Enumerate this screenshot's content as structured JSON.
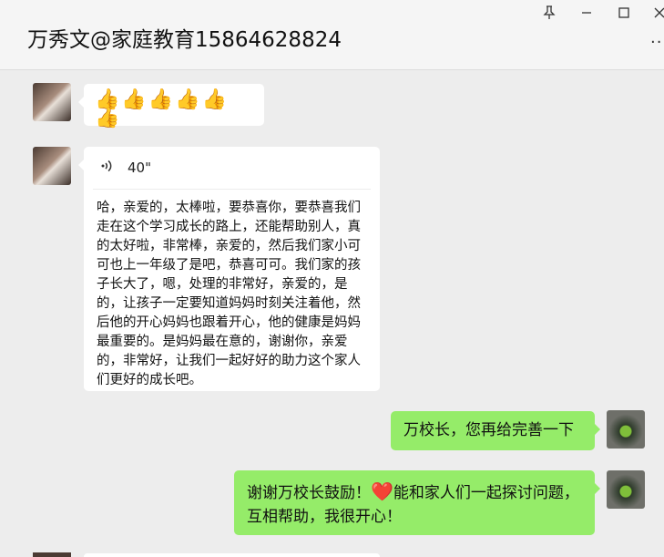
{
  "window": {
    "title": "万秀文@家庭教育15864628824",
    "pin_icon": "pin-icon",
    "minimize_icon": "minimize-icon",
    "maximize_icon": "maximize-icon",
    "close_icon": "close-icon",
    "more_icon": "more-icon"
  },
  "messages": [
    {
      "side": "left",
      "type": "emoji",
      "text": "👍👍👍👍👍👍"
    },
    {
      "side": "left",
      "type": "voice",
      "duration": "40\"",
      "transcript": "哈，亲爱的，太棒啦，要恭喜你，要恭喜我们走在这个学习成长的路上，还能帮助别人，真的太好啦，非常棒，亲爱的，然后我们家小可可也上一年级了是吧，恭喜可可。我们家的孩子长大了，嗯，处理的非常好，亲爱的，是的，让孩子一定要知道妈妈时刻关注着他，然后他的开心妈妈也跟着开心，他的健康是妈妈最重要的。是妈妈最在意的，谢谢你，亲爱的，非常好，让我们一起好好的助力这个家人们更好的成长吧。"
    },
    {
      "side": "right",
      "type": "text",
      "text": "万校长，您再给完善一下"
    },
    {
      "side": "right",
      "type": "text",
      "text_before": "谢谢万校长鼓励！",
      "heart": "❤️",
      "text_after": "能和家人们一起探讨问题，互相帮助，我很开心！"
    }
  ],
  "colors": {
    "background": "#ededed",
    "header": "#f5f5f5",
    "bubble_white": "#ffffff",
    "bubble_green": "#95ec69"
  }
}
